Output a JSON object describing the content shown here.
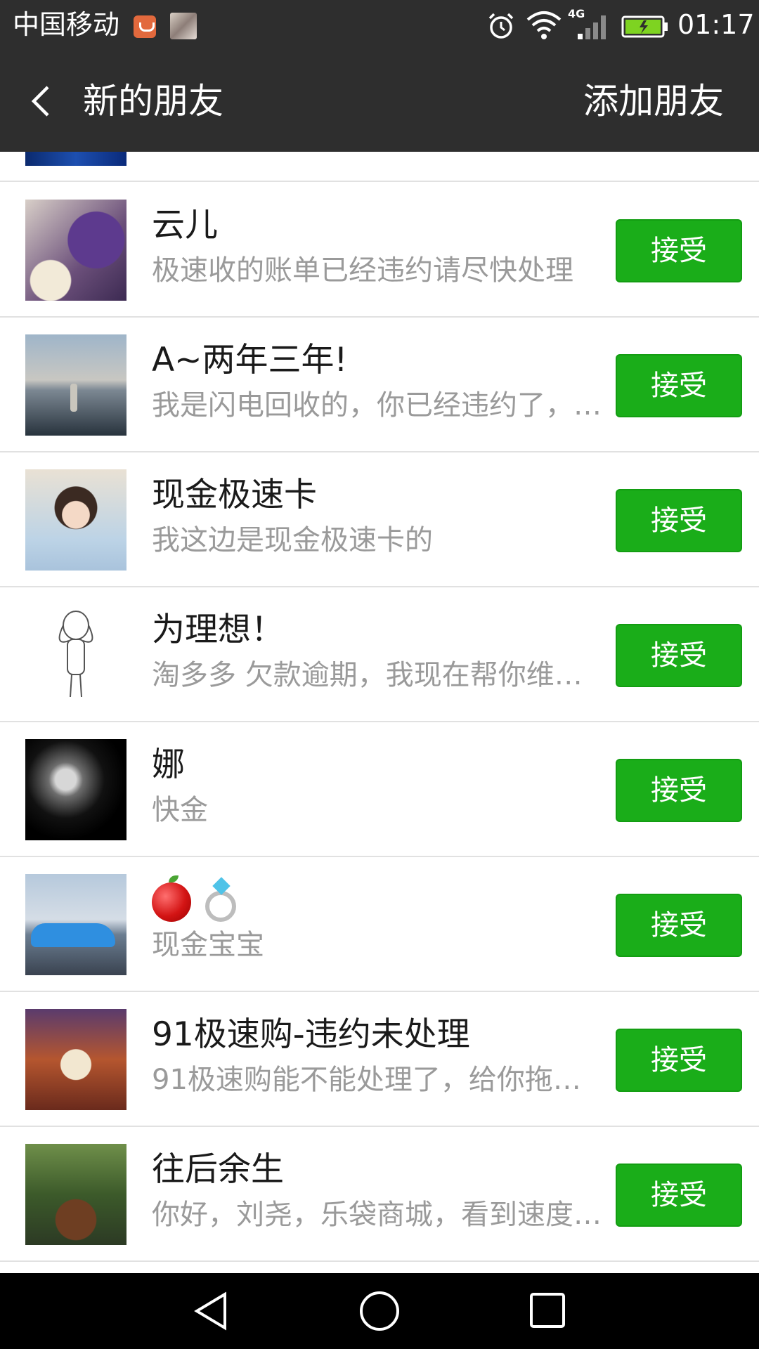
{
  "status_bar": {
    "carrier": "中国移动",
    "network": "4G",
    "time": "01:17",
    "icons": [
      "taobao-notification-icon",
      "image-notification-icon",
      "alarm-icon",
      "wifi-icon",
      "signal-icon",
      "battery-charging-icon"
    ]
  },
  "header": {
    "back_icon": "back-arrow-icon",
    "title": "新的朋友",
    "action": "添加朋友"
  },
  "accept_label": "接受",
  "requests": [
    {
      "name": "云儿",
      "message": "极速收的账单已经违约请尽快处理",
      "button": "接受"
    },
    {
      "name": "A~两年三年!",
      "message": "我是闪电回收的，你已经违约了，…",
      "button": "接受"
    },
    {
      "name": "现金极速卡",
      "message": "我这边是现金极速卡的",
      "button": "接受"
    },
    {
      "name": "为理想！",
      "message": "淘多多  欠款逾期，我现在帮你维…",
      "button": "接受"
    },
    {
      "name": "娜",
      "message": "快金",
      "button": "接受"
    },
    {
      "name": "",
      "name_emoji": [
        "red-apple-emoji",
        "ring-emoji"
      ],
      "message": "现金宝宝",
      "button": "接受"
    },
    {
      "name": "91极速购-违约未处理",
      "message": "91极速购能不能处理了，给你拖…",
      "button": "接受"
    },
    {
      "name": "往后余生",
      "message": "你好，刘尧，乐袋商城，看到速度…",
      "button": "接受"
    }
  ],
  "nav_bar": {
    "icons": [
      "nav-back-icon",
      "nav-home-icon",
      "nav-recent-icon"
    ]
  },
  "colors": {
    "header_bg": "#2e2e2e",
    "accept_green": "#1aad19",
    "secondary_text": "#9a9a9a",
    "divider": "#e1e1e1"
  }
}
